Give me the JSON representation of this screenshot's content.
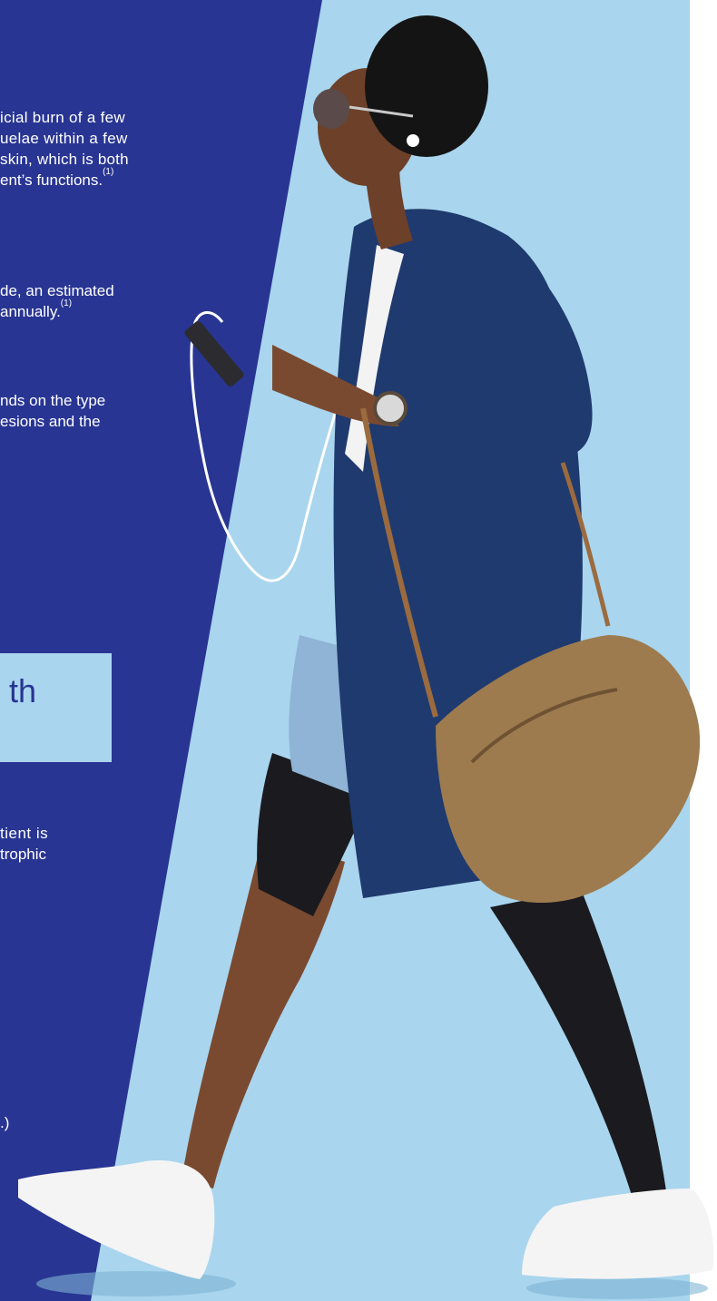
{
  "paragraphs": {
    "p1": {
      "line1": "icial burn of a few",
      "line2": "uelae within a few",
      "line3": "skin, which is both",
      "line4": "ent’s functions.",
      "ref": "(1)"
    },
    "p2": {
      "line1": "de, an estimated",
      "line2": "annually.",
      "ref": "(1)"
    },
    "p3": {
      "line1": "nds on the type",
      "line2": "esions and the"
    },
    "p4": {
      "line1": "tient is",
      "line2": "trophic"
    },
    "p5": {
      "line1": ".)"
    }
  },
  "heading_box": {
    "text": "th"
  },
  "colors": {
    "dark_blue": "#283593",
    "light_blue": "#a9d5ee",
    "white": "#ffffff"
  }
}
